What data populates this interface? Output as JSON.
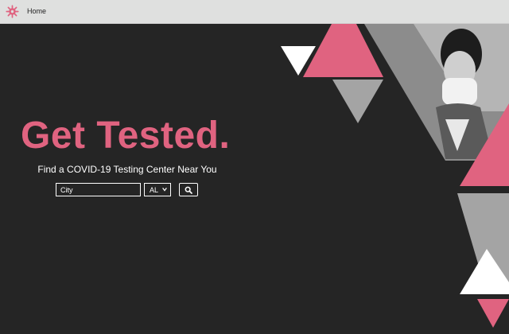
{
  "nav": {
    "home_label": "Home"
  },
  "hero": {
    "headline": "Get Tested.",
    "subtitle": "Find a COVID-19 Testing Center Near You"
  },
  "search": {
    "city_placeholder": "City",
    "state_selected": "AL"
  },
  "icons": {
    "logo": "virus-icon",
    "search": "search-icon",
    "select": "chevron-down-icon"
  },
  "colors": {
    "accent": "#e06380",
    "background": "#252525",
    "topbar": "#dfe0df",
    "grey_triangle": "#a4a4a4"
  }
}
